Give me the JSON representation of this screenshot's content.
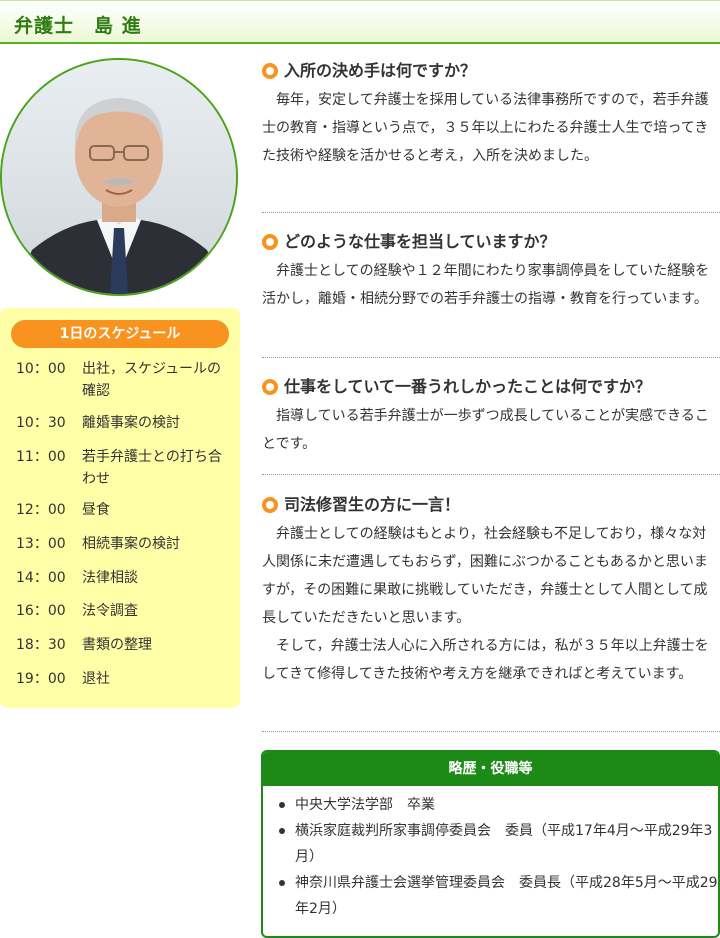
{
  "header": {
    "title": "弁護士　島 進"
  },
  "schedule": {
    "title": "1日のスケジュール",
    "items": [
      {
        "time": "10：00",
        "text": "出社，スケジュールの確認"
      },
      {
        "time": "10：30",
        "text": "離婚事案の検討"
      },
      {
        "time": "11：00",
        "text": "若手弁護士との打ち合わせ"
      },
      {
        "time": "12：00",
        "text": "昼食"
      },
      {
        "time": "13：00",
        "text": "相続事案の検討"
      },
      {
        "time": "14：00",
        "text": "法律相談"
      },
      {
        "time": "16：00",
        "text": "法令調査"
      },
      {
        "time": "18：30",
        "text": "書類の整理"
      },
      {
        "time": "19：00",
        "text": "退社"
      }
    ]
  },
  "qa": [
    {
      "question": "入所の決め手は何ですか？",
      "answer": [
        "毎年，安定して弁護士を採用している法律事務所ですので，若手弁護士の教育・指導という点で，３５年以上にわたる弁護士人生で培ってきた技術や経験を活かせると考え，入所を決めました。"
      ]
    },
    {
      "question": "どのような仕事を担当していますか？",
      "answer": [
        "弁護士としての経験や１２年間にわたり家事調停員をしていた経験を活かし，離婚・相続分野での若手弁護士の指導・教育を行っています。"
      ]
    },
    {
      "question": "仕事をしていて一番うれしかったことは何ですか？",
      "answer": [
        "指導している若手弁護士が一歩ずつ成長していることが実感できることです。"
      ]
    },
    {
      "question": "司法修習生の方に一言！",
      "answer": [
        "弁護士としての経験はもとより，社会経験も不足しており，様々な対人関係に未だ遭遇してもおらず，困難にぶつかることもあるかと思いますが，その困難に果敢に挑戦していただき，弁護士として人間として成長していただきたいと思います。",
        "そして，弁護士法人心に入所される方には，私が３５年以上弁護士をしてきて修得してきた技術や考え方を継承できればと考えています。"
      ]
    }
  ],
  "career": {
    "title": "略歴・役職等",
    "items": [
      "中央大学法学部　卒業",
      "横浜家庭裁判所家事調停委員会　委員（平成17年4月～平成29年3月）",
      "神奈川県弁護士会選挙管理委員会　委員長（平成28年5月～平成29年2月）"
    ]
  }
}
